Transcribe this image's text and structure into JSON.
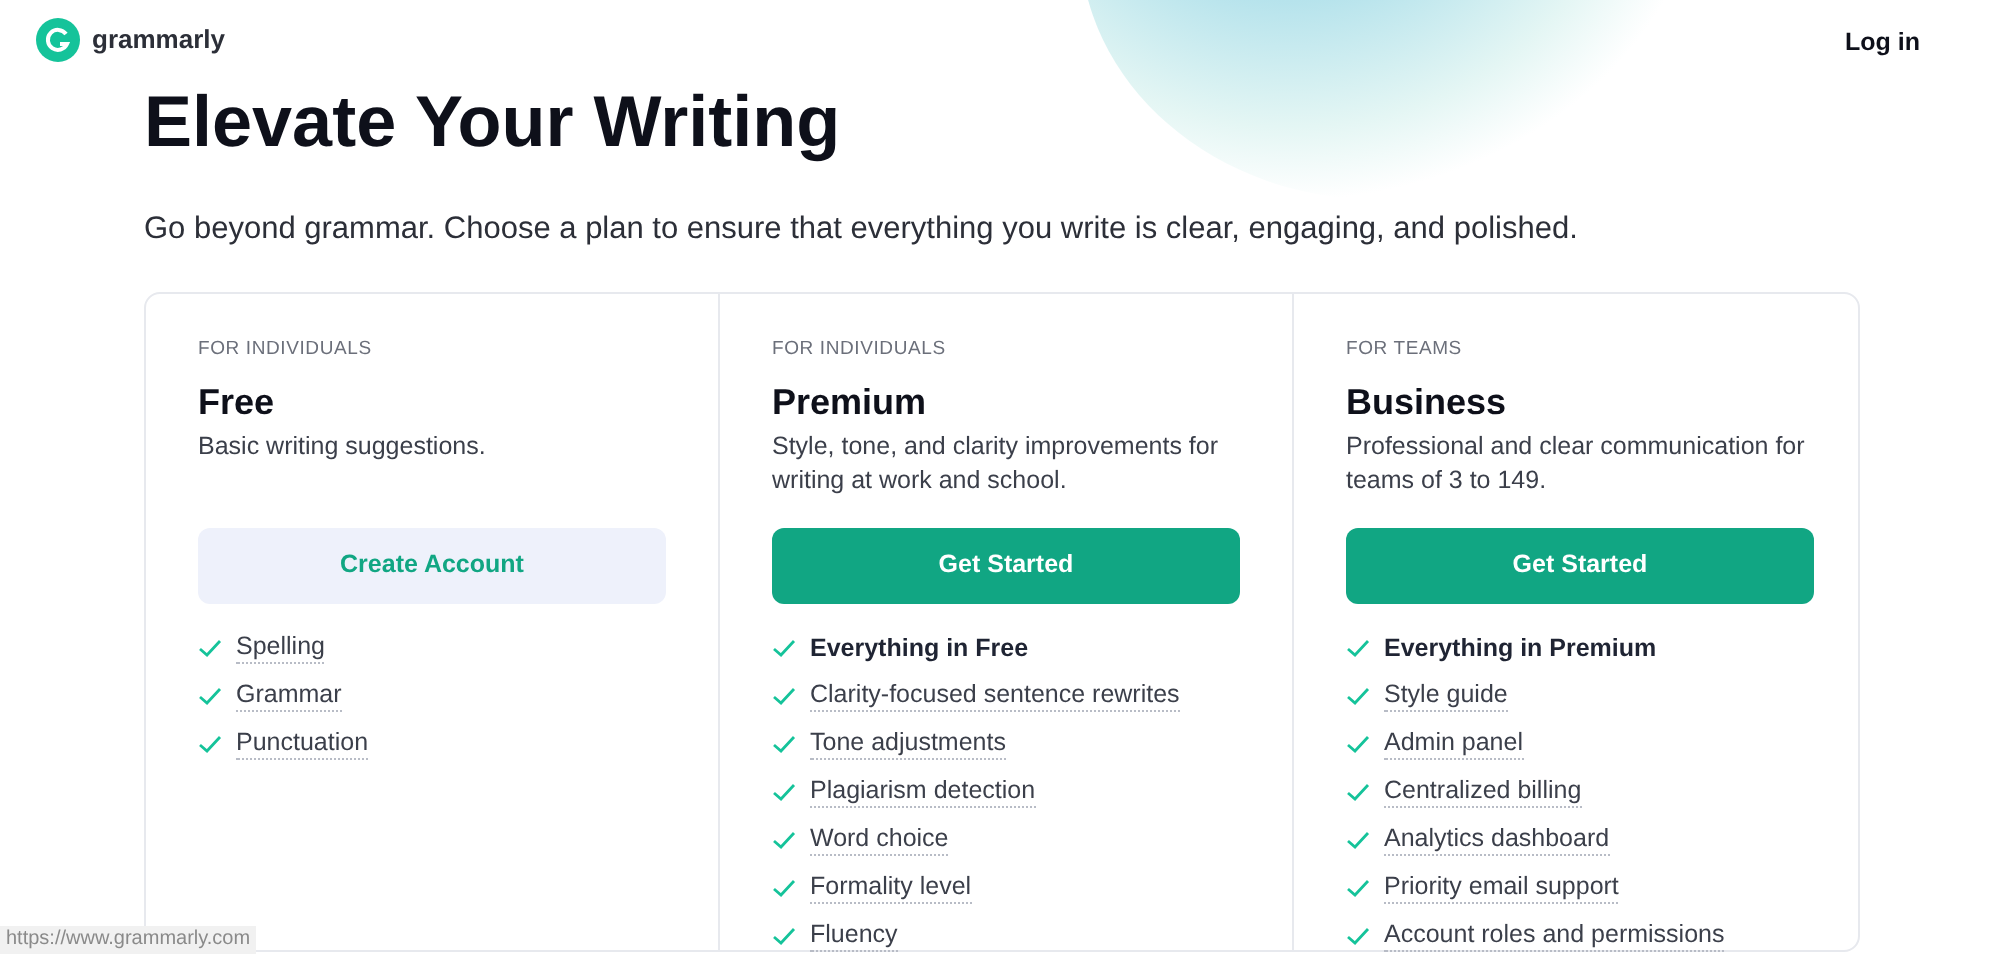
{
  "header": {
    "brand": "grammarly",
    "login": "Log in"
  },
  "title": "Elevate Your Writing",
  "subtitle": "Go beyond grammar. Choose a plan to ensure that everything you write is clear, engaging, and polished.",
  "plans": [
    {
      "audience": "FOR INDIVIDUALS",
      "name": "Free",
      "description": "Basic writing suggestions.",
      "button": {
        "label": "Create Account",
        "kind": "secondary"
      },
      "features": [
        {
          "label": "Spelling",
          "kind": "feature"
        },
        {
          "label": "Grammar",
          "kind": "feature"
        },
        {
          "label": "Punctuation",
          "kind": "feature"
        }
      ]
    },
    {
      "audience": "FOR INDIVIDUALS",
      "name": "Premium",
      "description": "Style, tone, and clarity improvements for writing at work and school.",
      "button": {
        "label": "Get Started",
        "kind": "primary"
      },
      "features": [
        {
          "label": "Everything in Free",
          "kind": "summary"
        },
        {
          "label": "Clarity-focused sentence rewrites",
          "kind": "feature"
        },
        {
          "label": "Tone adjustments",
          "kind": "feature"
        },
        {
          "label": "Plagiarism detection",
          "kind": "feature"
        },
        {
          "label": "Word choice",
          "kind": "feature"
        },
        {
          "label": "Formality level",
          "kind": "feature"
        },
        {
          "label": "Fluency",
          "kind": "feature"
        }
      ]
    },
    {
      "audience": "FOR TEAMS",
      "name": "Business",
      "description": "Professional and clear communication for teams of 3 to 149.",
      "button": {
        "label": "Get Started",
        "kind": "primary"
      },
      "features": [
        {
          "label": "Everything in Premium",
          "kind": "summary"
        },
        {
          "label": "Style guide",
          "kind": "feature"
        },
        {
          "label": "Admin panel",
          "kind": "feature"
        },
        {
          "label": "Centralized billing",
          "kind": "feature"
        },
        {
          "label": "Analytics dashboard",
          "kind": "feature"
        },
        {
          "label": "Priority email support",
          "kind": "feature"
        },
        {
          "label": "Account roles and permissions",
          "kind": "feature"
        }
      ]
    }
  ],
  "status_bar": "https://www.grammarly.com"
}
